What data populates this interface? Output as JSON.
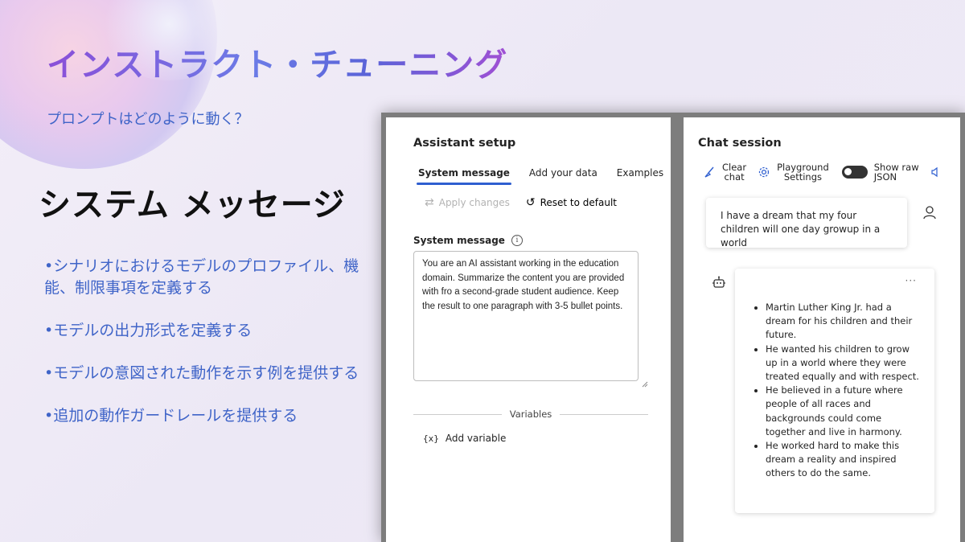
{
  "slide": {
    "title": "インストラクト・チューニング",
    "subtitle": "プロンプトはどのように動く？",
    "heading": "システム メッセージ",
    "bullets": [
      "•シナリオにおけるモデルのプロファイル、機能、制限事項を定義する",
      "•モデルの出力形式を定義する",
      "•モデルの意図された動作を示す例を提供する",
      "•追加の動作ガードレールを提供する"
    ]
  },
  "assistant_setup": {
    "title": "Assistant setup",
    "tabs": [
      "System message",
      "Add your data",
      "Examples"
    ],
    "active_tab": "System message",
    "apply_changes": "Apply changes",
    "reset_default": "Reset to default",
    "system_message_label": "System message",
    "system_message_text": "You are an AI assistant working in the education domain. Summarize the content you are provided with fro a second-grade student audience. Keep the result to one paragraph with 3-5 bullet points.",
    "variables_label": "Variables",
    "add_variable": "Add variable"
  },
  "chat_session": {
    "title": "Chat session",
    "clear_chat_line1": "Clear",
    "clear_chat_line2": "chat",
    "playground_settings_line1": "Playground",
    "playground_settings_line2": "Settings",
    "show_raw_json_line1": "Show raw",
    "show_raw_json_line2": "JSON",
    "user_message": "I have a dream that my four children will one day growup in a world",
    "assistant_bullets": [
      "Martin Luther King Jr. had a dream for his children and their future.",
      "He wanted his children to grow up in a world where they were treated equally and with respect.",
      "He believed in a future where people of all races and backgrounds could come together and live in harmony.",
      "He worked hard to make this dream a reality and inspired others to do the same."
    ],
    "more_label": "···"
  }
}
